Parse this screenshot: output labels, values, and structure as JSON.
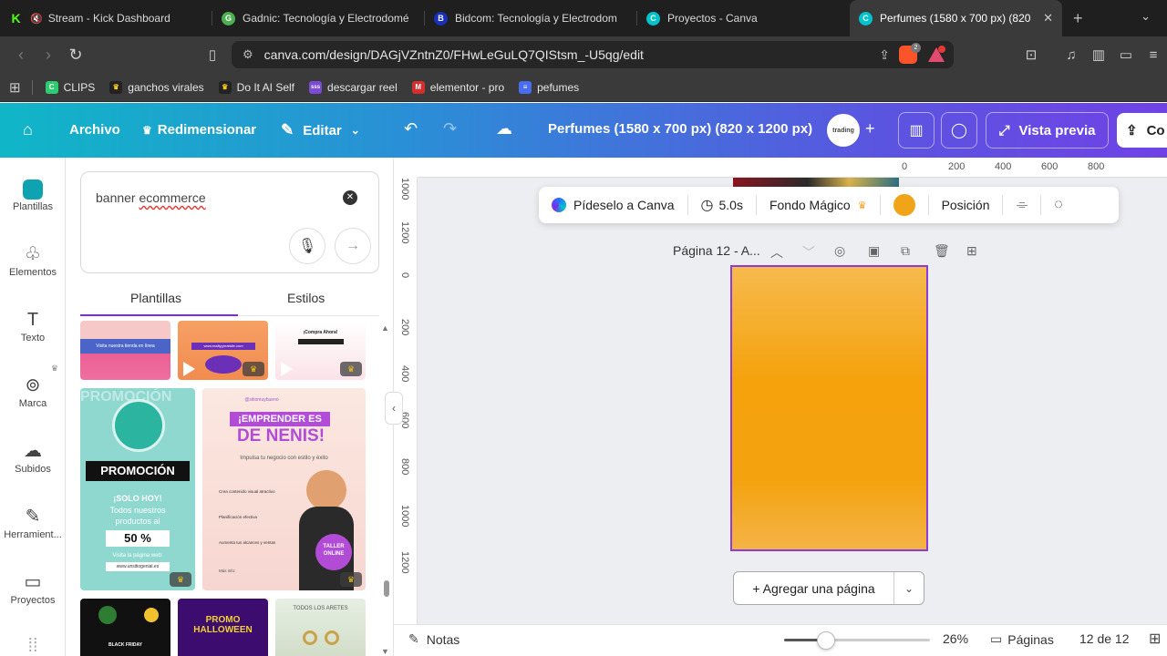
{
  "browser": {
    "tabs": [
      {
        "title": "Stream - Kick Dashboard",
        "favicon_color": "#53fc18",
        "glyph": "K",
        "active": false
      },
      {
        "title": "Gadnic: Tecnología y Electrodomé",
        "favicon_color": "#4caf50",
        "glyph": "G",
        "active": false
      },
      {
        "title": "Bidcom: Tecnología y Electrodom",
        "favicon_color": "#1a2fb8",
        "glyph": "B",
        "active": false
      },
      {
        "title": "Proyectos - Canva",
        "favicon_color": "#00c4cc",
        "glyph": "C",
        "active": false
      },
      {
        "title": "Perfumes (1580 x 700 px) (820",
        "favicon_color": "#00c4cc",
        "glyph": "C",
        "active": true
      }
    ],
    "url": "canva.com/design/DAGjVZntnZ0/FHwLeGuLQ7QIStsm_-U5qg/edit",
    "brave_badge": "2",
    "bookmarks": [
      {
        "label": "CLIPS",
        "color": "#2ecc71",
        "glyph": "C"
      },
      {
        "label": "ganchos virales",
        "color": "#222222",
        "glyph": "♛"
      },
      {
        "label": "Do It AI Self",
        "color": "#222222",
        "glyph": "♛"
      },
      {
        "label": "descargar reel",
        "color": "#7b4bd8",
        "glyph": "sss"
      },
      {
        "label": "elementor - pro",
        "color": "#d32f2f",
        "glyph": "M"
      },
      {
        "label": "pefumes",
        "color": "#4a6cf0",
        "glyph": "≡"
      }
    ]
  },
  "canva_header": {
    "file": "Archivo",
    "resize": "Redimensionar",
    "edit": "Editar",
    "doc_title": "Perfumes (1580 x 700 px) (820 x 1200 px)",
    "avatar_text": "trading",
    "preview": "Vista previa",
    "share": "Co"
  },
  "rail": [
    {
      "label": "Plantillas",
      "icon": "templates-icon"
    },
    {
      "label": "Elementos",
      "icon": "elements-icon"
    },
    {
      "label": "Texto",
      "icon": "text-icon"
    },
    {
      "label": "Marca",
      "icon": "brand-icon"
    },
    {
      "label": "Subidos",
      "icon": "uploads-icon"
    },
    {
      "label": "Herramient...",
      "icon": "tools-icon"
    },
    {
      "label": "Proyectos",
      "icon": "projects-icon"
    }
  ],
  "panel": {
    "search_prefix": "banner ",
    "search_misspelled": "ecommerce",
    "tab_templates": "Plantillas",
    "tab_styles": "Estilos"
  },
  "thumbnails": {
    "t1_text": "Visita nuestra tienda en línea",
    "t2_text": "www.reallygreatsite.com",
    "t3_text": "¡Compra Ahora!",
    "promo_header": "PROMOCIÓN",
    "promo_sub": "¡SOLO HOY!",
    "promo_body": "Todos nuestros productos al",
    "promo_percent": "50 %",
    "promo_link": "Visita la página web:",
    "promo_site": "www.unsitiogenial.es",
    "emp_handle": "@sitiomuybueno",
    "emp_title1": "¡EMPRENDER ES",
    "emp_title2": "DE NENIS!",
    "emp_sub": "Impulsa tu negocio con estilo y éxito",
    "emp_items": [
      "Crea contenido visual atractivo",
      "Planificación efectiva",
      "Aumenta tus alcances y ventas"
    ],
    "emp_badge": "TALLER ONLINE",
    "emp_more": "Más info:",
    "b1_text": "BLACK FRIDAY",
    "b2_text1": "PROMO",
    "b2_text2": "HALLOWEEN",
    "b3_text": "TODOS LOS ARETES"
  },
  "rulers": {
    "h_ticks": [
      "0",
      "200",
      "400",
      "600",
      "800"
    ],
    "v_ticks": [
      "1000",
      "1200",
      "0",
      "200",
      "400",
      "600",
      "800",
      "1000",
      "1200"
    ]
  },
  "context_toolbar": {
    "ask": "Pídeselo a Canva",
    "duration": "5.0s",
    "magic_bg": "Fondo Mágico",
    "color": "#f2a418",
    "position": "Posición"
  },
  "page": {
    "label": "Página 12 - A...",
    "add_page": "+ Agregar una página"
  },
  "bottom": {
    "notes": "Notas",
    "zoom": "26%",
    "zoom_fraction": 0.26,
    "pages": "Páginas",
    "page_count": "12 de 12"
  }
}
